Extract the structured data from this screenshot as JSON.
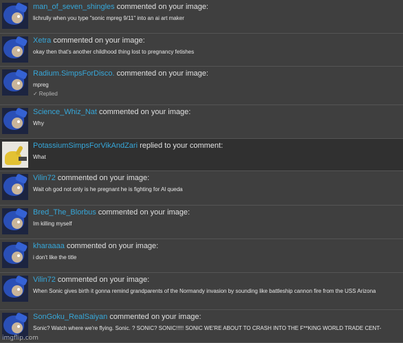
{
  "notifications": [
    {
      "username": "man_of_seven_shingles",
      "action": "commented on your image:",
      "text": "lichrully when you type \"sonic mpreg 9/11\" into an ai art maker",
      "avatar_icon": "sonic-avatar-icon"
    },
    {
      "username": "Xetra",
      "action": "commented on your image:",
      "text": "okay then that's another childhood thing lost to pregnancy fetishes",
      "avatar_icon": "sonic-avatar-icon"
    },
    {
      "username": "Radium.SimpsForDisco.",
      "action": "commented on your image:",
      "text": "mpreg",
      "replied_label": "Replied",
      "avatar_icon": "sonic-avatar-icon"
    },
    {
      "username": "Science_Whiz_Nat",
      "action": "commented on your image:",
      "text": "Why",
      "avatar_icon": "sonic-avatar-icon"
    },
    {
      "username": "PotassiumSimpsForVikAndZari",
      "action": "replied to your comment:",
      "text": "What",
      "avatar_icon": "pikachu-avatar-icon",
      "highlighted": true
    },
    {
      "username": "Vilin72",
      "action": "commented on your image:",
      "text": "Wait oh god not only is he pregnant he is fighting for Al queda",
      "avatar_icon": "sonic-avatar-icon"
    },
    {
      "username": "Bred_The_Blorbus",
      "action": "commented on your image:",
      "text": "Im killing myself",
      "avatar_icon": "sonic-avatar-icon"
    },
    {
      "username": "kharaaaa",
      "action": "commented on your image:",
      "text": "i don't like the title",
      "avatar_icon": "sonic-avatar-icon"
    },
    {
      "username": "Vilin72",
      "action": "commented on your image:",
      "text": "When Sonic gives birth it gonna remind grandparents of the Normandy invasion by sounding like battleship cannon fire from the USS Arizona",
      "avatar_icon": "sonic-avatar-icon"
    },
    {
      "username": "SonGoku_RealSaiyan",
      "action": "commented on your image:",
      "text": "Sonic? Watch where we're flying. Sonic. ? SONIC? SONIC!!!!! SONIC WE'RE ABOUT TO CRASH INTO THE F**KING WORLD TRADE CENT-",
      "avatar_icon": "sonic-avatar-icon"
    }
  ],
  "watermark": "imgflip.com",
  "colors": {
    "username": "#36a7d9",
    "background": "#3f3f3f",
    "highlight_background": "#303030"
  }
}
